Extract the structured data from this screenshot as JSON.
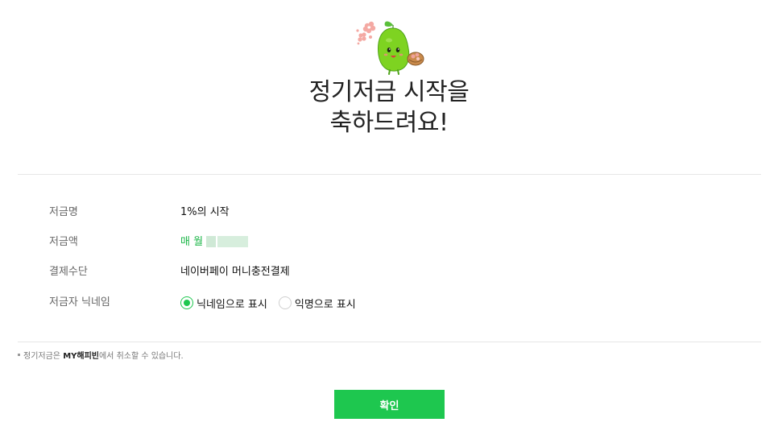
{
  "header": {
    "mascot_icon": "bean-mascot-icon",
    "title_line1": "정기저금 시작을",
    "title_line2": "축하드려요!"
  },
  "details": {
    "name_label": "저금명",
    "name_value": "1%의 시작",
    "amount_label": "저금액",
    "amount_value": "매 월",
    "payment_label": "결제수단",
    "payment_value": "네이버페이 머니충전결제",
    "nickname_label": "저금자 닉네임",
    "nickname_options": [
      {
        "label": "닉네임으로 표시",
        "selected": true
      },
      {
        "label": "익명으로 표시",
        "selected": false
      }
    ]
  },
  "notice": {
    "before": "정기저금은 ",
    "highlight": "MY해피빈",
    "after": "에서 취소할 수 있습니다."
  },
  "confirm_label": "확인",
  "colors": {
    "accent": "#1ec74f",
    "amount_text": "#1ab546"
  }
}
